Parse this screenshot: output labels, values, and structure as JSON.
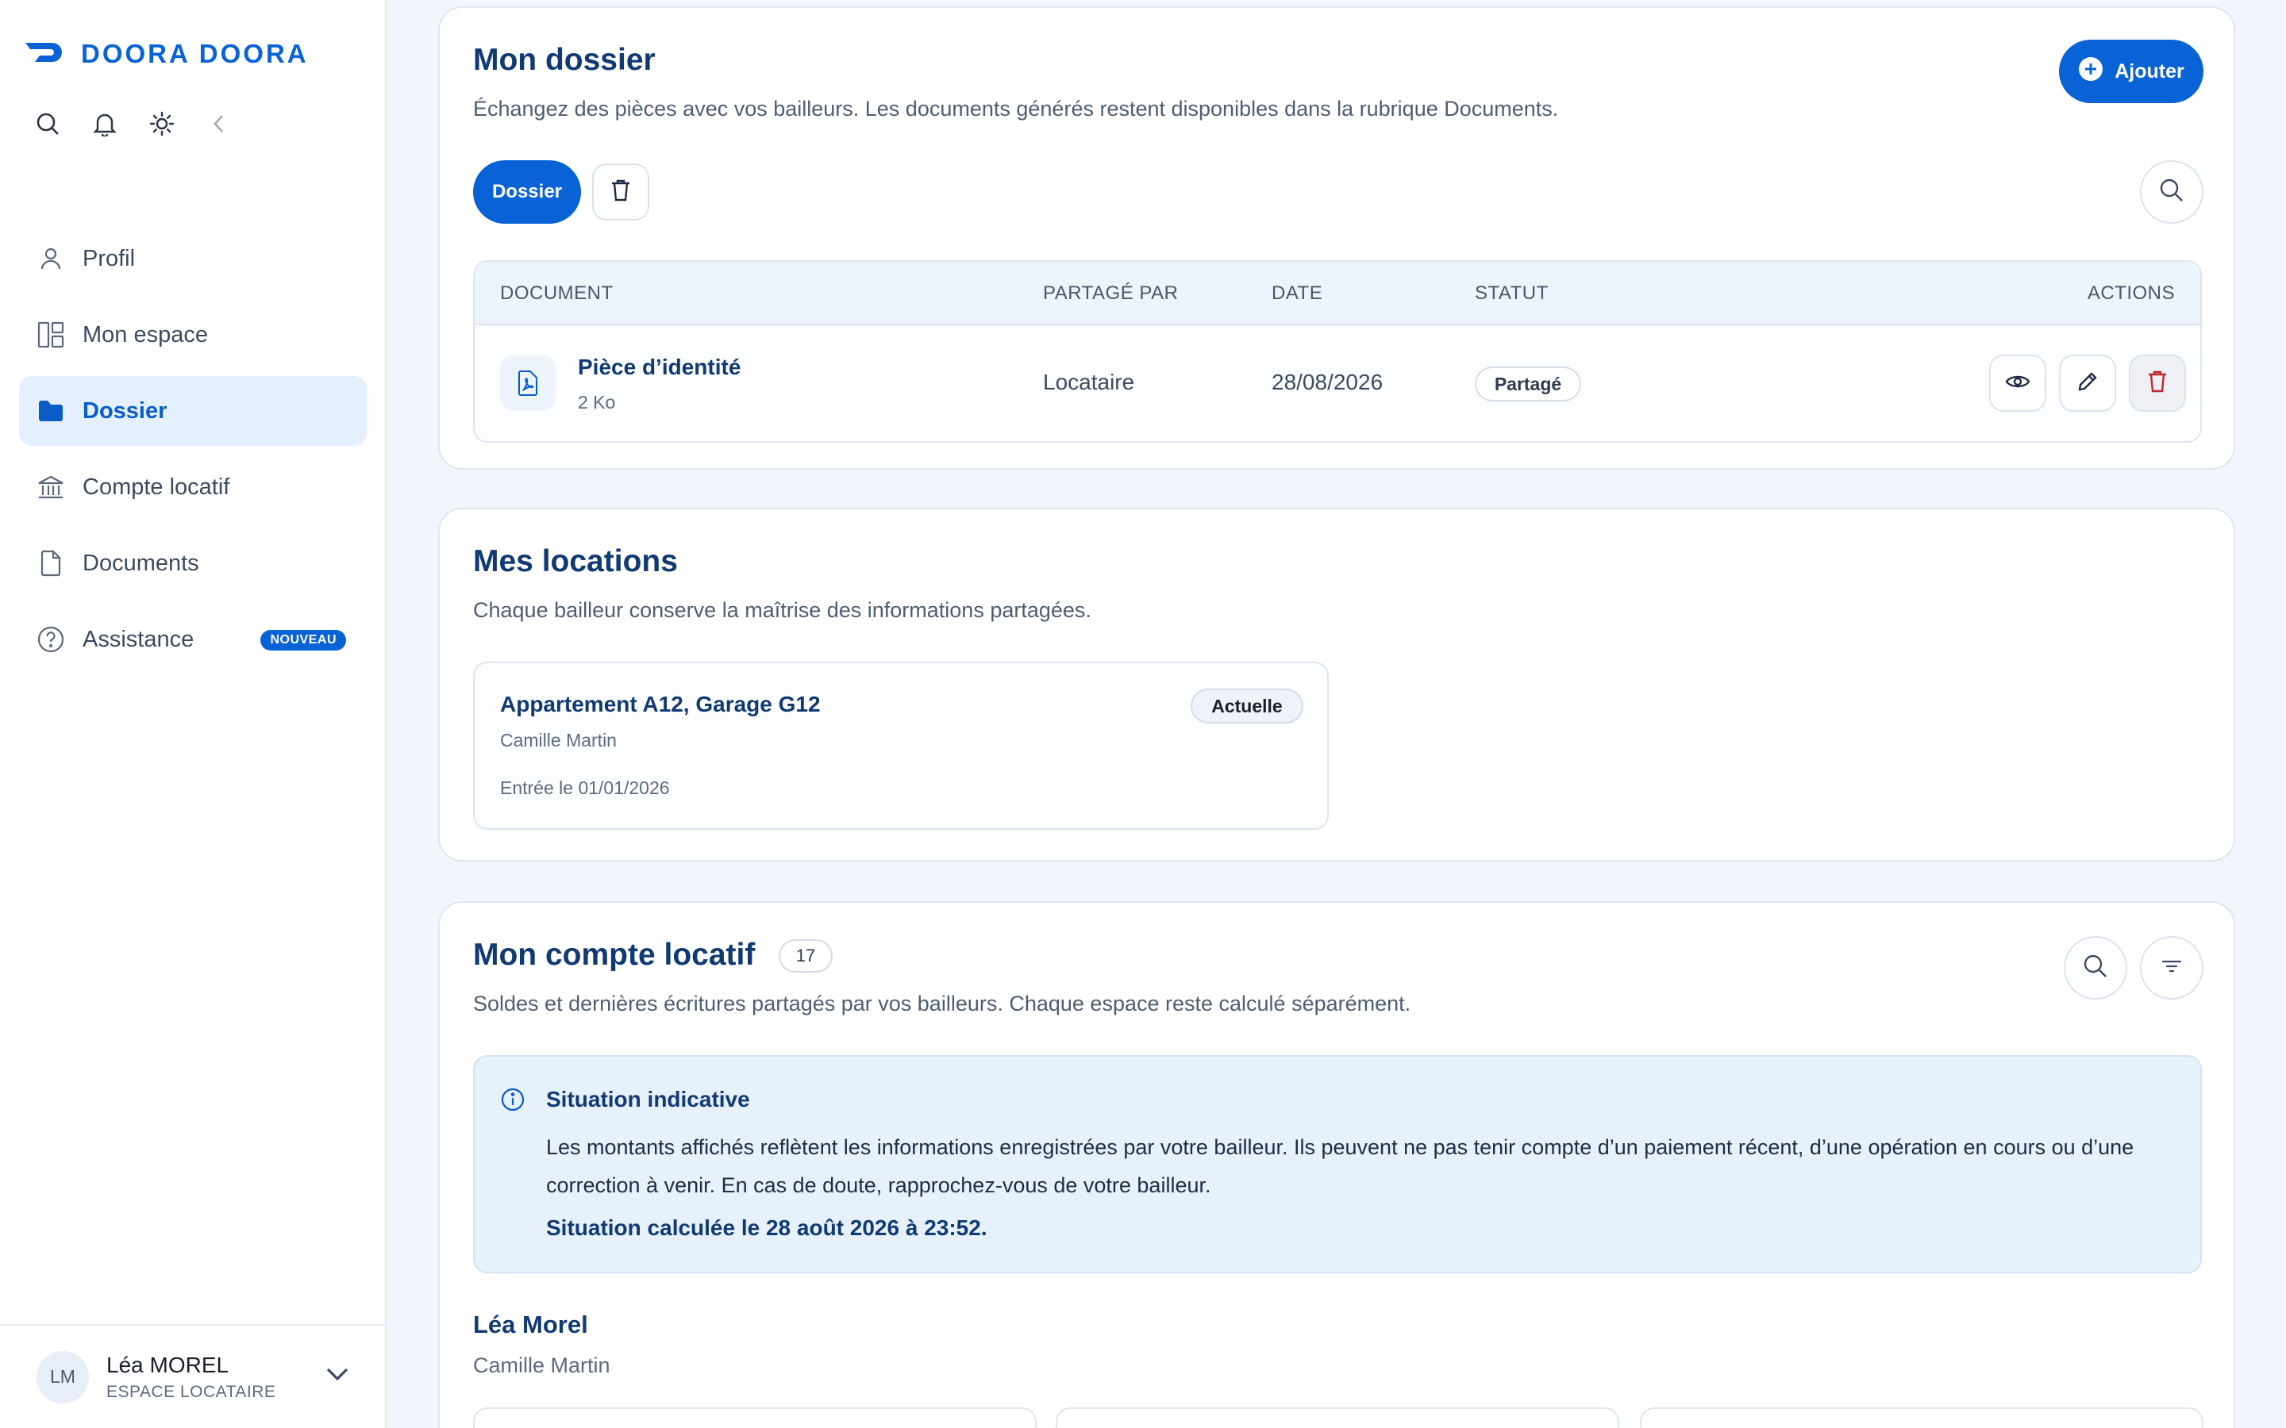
{
  "brand": {
    "name": "DOORA DOORA",
    "color": "#0a63d6"
  },
  "toolbar": {
    "icons": [
      "search-icon",
      "bell-icon",
      "sun-icon",
      "collapse-icon"
    ]
  },
  "nav": {
    "items": [
      {
        "label": "Profil",
        "icon": "user-icon",
        "active": false
      },
      {
        "label": "Mon espace",
        "icon": "dashboard-icon",
        "active": false
      },
      {
        "label": "Dossier",
        "icon": "folder-icon",
        "active": true
      },
      {
        "label": "Compte locatif",
        "icon": "bank-icon",
        "active": false
      },
      {
        "label": "Documents",
        "icon": "document-icon",
        "active": false
      },
      {
        "label": "Assistance",
        "icon": "help-icon",
        "active": false,
        "badge": "NOUVEAU"
      }
    ]
  },
  "user": {
    "initials": "LM",
    "name": "Léa MOREL",
    "role": "ESPACE LOCATAIRE"
  },
  "dossier": {
    "title": "Mon dossier",
    "subtitle": "Échangez des pièces avec vos bailleurs. Les documents générés restent disponibles dans la rubrique Documents.",
    "add_label": "Ajouter",
    "filter_label": "Dossier",
    "columns": {
      "document": "DOCUMENT",
      "shared_by": "PARTAGÉ PAR",
      "date": "DATE",
      "status": "STATUT",
      "actions": "ACTIONS"
    },
    "rows": [
      {
        "name": "Pièce d’identité",
        "size": "2 Ko",
        "shared_by": "Locataire",
        "date": "28/08/2026",
        "status": "Partagé"
      }
    ]
  },
  "locations": {
    "title": "Mes locations",
    "subtitle": "Chaque bailleur conserve la maîtrise des informations partagées.",
    "items": [
      {
        "title": "Appartement A12, Garage G12",
        "owner": "Camille Martin",
        "entry": "Entrée le 01/01/2026",
        "status": "Actuelle"
      }
    ]
  },
  "account": {
    "title": "Mon compte locatif",
    "count": "17",
    "subtitle": "Soldes et dernières écritures partagés par vos bailleurs. Chaque espace reste calculé séparément.",
    "info": {
      "title": "Situation indicative",
      "text": "Les montants affichés reflètent les informations enregistrées par votre bailleur. Ils peuvent ne pas tenir compte d’un paiement récent, d’une opération en cours ou d’une correction à venir. En cas de doute, rapprochez-vous de votre bailleur.",
      "calc": "Situation calculée le 28 août 2026 à 23:52."
    },
    "tenant": {
      "name": "Léa Morel",
      "landlord": "Camille Martin"
    }
  }
}
